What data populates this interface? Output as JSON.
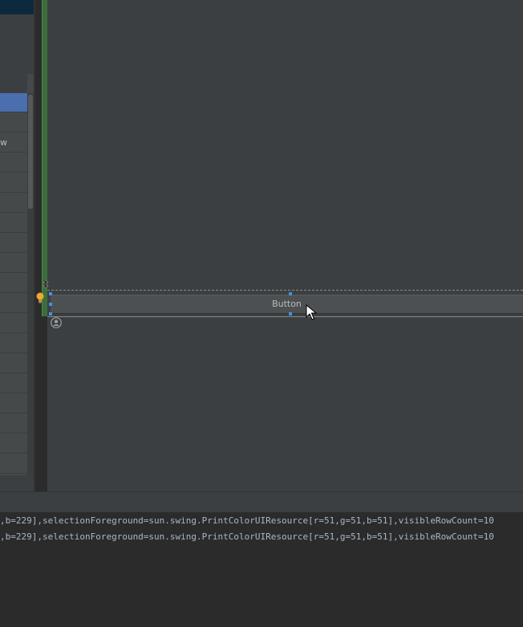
{
  "palette": {
    "items": [
      {
        "label": "",
        "selected": true
      },
      {
        "label": ""
      },
      {
        "label": "w"
      },
      {
        "label": ""
      },
      {
        "label": ""
      },
      {
        "label": ""
      },
      {
        "label": ""
      },
      {
        "label": ""
      },
      {
        "label": ""
      },
      {
        "label": ""
      },
      {
        "label": ""
      },
      {
        "label": ""
      },
      {
        "label": ""
      },
      {
        "label": ""
      },
      {
        "label": ""
      },
      {
        "label": ""
      },
      {
        "label": ""
      },
      {
        "label": ""
      },
      {
        "label": ""
      }
    ]
  },
  "designer": {
    "widget_button_label": "Button"
  },
  "console": {
    "lines": [
      ",b=229],selectionForeground=sun.swing.PrintColorUIResource[r=51,g=51,b=51],visibleRowCount=10",
      ",b=229],selectionForeground=sun.swing.PrintColorUIResource[r=51,g=51,b=51],visibleRowCount=10"
    ]
  },
  "colors": {
    "selection": "#4b6eaf",
    "handle": "#4a90e2",
    "bulb": "#f0a732",
    "margin_bar": "#3b6e3b"
  },
  "icons": {
    "bulb": "lightbulb-icon",
    "avatar": "person-icon",
    "cursor": "mouse-pointer-icon",
    "resize": "resize-arrow-icon"
  }
}
